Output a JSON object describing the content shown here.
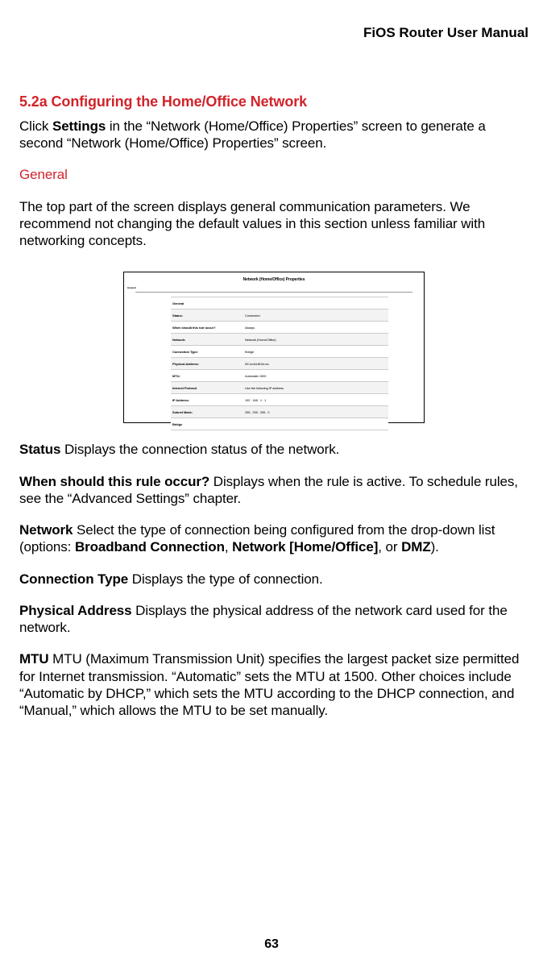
{
  "header": {
    "title": "FiOS Router User Manual"
  },
  "section": {
    "number_title": "5.2a  Configuring the Home/Office Network",
    "intro_pre": "Click ",
    "intro_bold": "Settings",
    "intro_post": " in the “Network (Home/Office) Properties” screen to generate a second “Network (Home/Office) Properties” screen.",
    "general_label": "General",
    "general_body": "The top part of the screen displays general communication parameters. We recommend not changing the default values in this section unless familiar with networking concepts."
  },
  "figure": {
    "caption": "Network (Home/Office) Properties",
    "tab": "General",
    "rows": [
      {
        "label": "General",
        "value": "",
        "alt": false
      },
      {
        "label": "Status:",
        "value": "Connected",
        "alt": true
      },
      {
        "label": "When should this rule occur?",
        "value": "Always",
        "alt": false
      },
      {
        "label": "Network:",
        "value": "Network (Home/Office)",
        "alt": true
      },
      {
        "label": "Connection Type:",
        "value": "Bridge",
        "alt": false
      },
      {
        "label": "Physical Address:",
        "value": "00:1a:6d:8f:0e:ea",
        "alt": true
      },
      {
        "label": "MTU:",
        "value": "Automatic   1500",
        "alt": false
      },
      {
        "label": "Internet Protocol",
        "value": "Use the following IP address",
        "alt": true
      },
      {
        "label": "IP Address:",
        "value": "192 . 168 . 1 . 1",
        "alt": false
      },
      {
        "label": "Subnet Mask:",
        "value": "255 . 255 . 255 . 0",
        "alt": true
      },
      {
        "label": "Bridge",
        "value": "",
        "alt": false
      }
    ]
  },
  "defs": {
    "status": {
      "term": "Status",
      "body": "  Displays the connection status of the network."
    },
    "rule": {
      "term": "When should this rule occur?",
      "body": "  Displays when the rule is active. To schedule rules, see the “Advanced Settings” chapter."
    },
    "network_pre": "Network",
    "network_body_1": "  Select the type of connection being configured from the drop-down list (options: ",
    "network_opt1": "Broadband Connection",
    "network_sep1": ", ",
    "network_opt2": "Network [Home/Office]",
    "network_sep2": ", or ",
    "network_opt3": "DMZ",
    "network_end": ").",
    "conn": {
      "term": "Connection Type",
      "body": "  Displays the type of connection."
    },
    "phys": {
      "term": "Physical Address",
      "body": "  Displays the physical address of the network card used for the network."
    },
    "mtu": {
      "term": "MTU",
      "body": "  MTU (Maximum Transmission Unit) specifies the largest packet size permitted for Internet transmission. “Automatic” sets the MTU at 1500. Other choices include “Automatic by DHCP,” which sets the MTU according to the DHCP connection, and “Manual,” which allows the MTU to be set manually."
    }
  },
  "page_number": "63"
}
